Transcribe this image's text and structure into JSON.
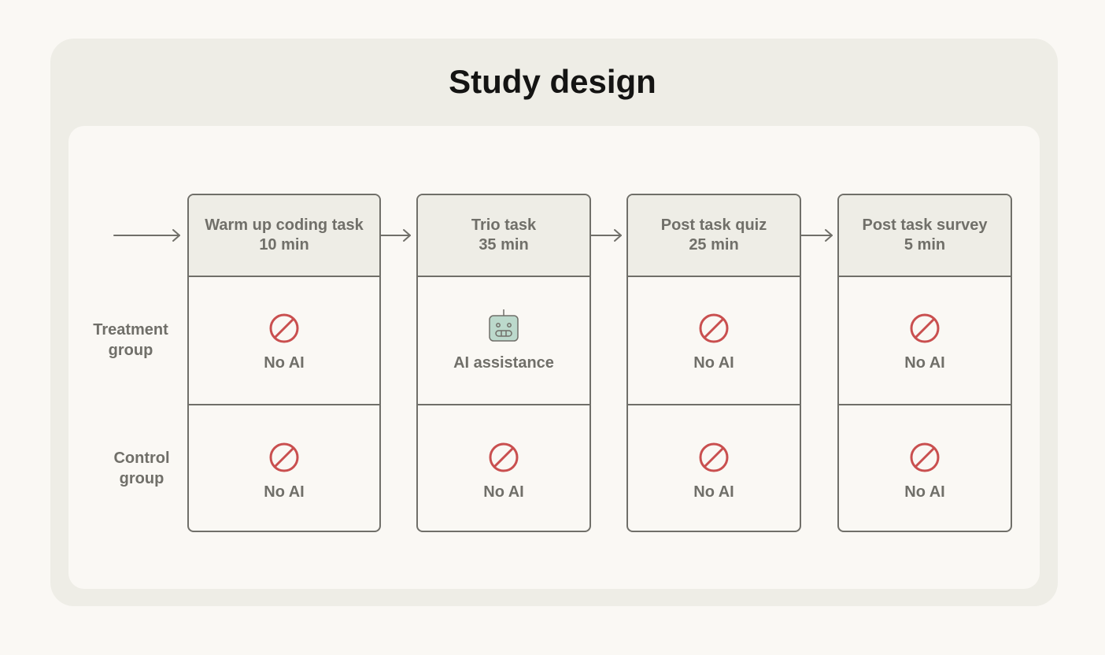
{
  "title": "Study design",
  "row_labels": {
    "treatment": [
      "Treatment",
      "group"
    ],
    "control": [
      "Control",
      "group"
    ]
  },
  "stages": [
    {
      "name": "Warm up coding task",
      "duration": "10 min",
      "treatment": {
        "icon": "no-ai-icon",
        "label": "No AI"
      },
      "control": {
        "icon": "no-ai-icon",
        "label": "No AI"
      }
    },
    {
      "name": "Trio task",
      "duration": "35 min",
      "treatment": {
        "icon": "robot-icon",
        "label": "AI assistance"
      },
      "control": {
        "icon": "no-ai-icon",
        "label": "No AI"
      }
    },
    {
      "name": "Post task quiz",
      "duration": "25 min",
      "treatment": {
        "icon": "no-ai-icon",
        "label": "No AI"
      },
      "control": {
        "icon": "no-ai-icon",
        "label": "No AI"
      }
    },
    {
      "name": "Post task survey",
      "duration": "5 min",
      "treatment": {
        "icon": "no-ai-icon",
        "label": "No AI"
      },
      "control": {
        "icon": "no-ai-icon",
        "label": "No AI"
      }
    }
  ],
  "colors": {
    "stroke": "#706f69",
    "no_ai_red": "#c94f4f",
    "robot_fill": "#bcd9cc"
  }
}
